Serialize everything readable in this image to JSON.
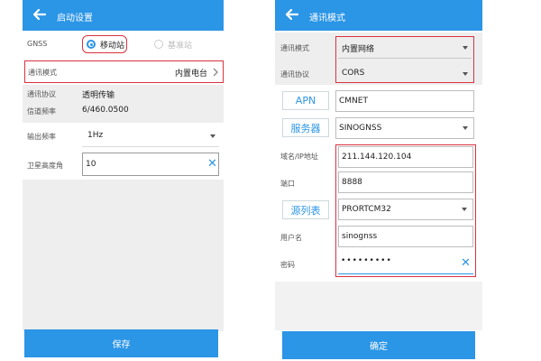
{
  "left": {
    "title": "启动设置",
    "gnss_label": "GNSS",
    "mode_mobile": "移动站",
    "mode_base": "基准站",
    "comm_mode_label": "通讯模式",
    "comm_mode_value": "内置电台",
    "protocol_label": "通讯协议",
    "protocol_value": "透明传输",
    "freq_label": "信道频率",
    "freq_value": "6/460.0500",
    "output_label": "输出频率",
    "output_value": "1Hz",
    "elev_label": "卫星高度角",
    "elev_value": "10",
    "save_label": "保存"
  },
  "right": {
    "title": "通讯模式",
    "comm_mode_label": "通讯模式",
    "comm_mode_value": "内置网络",
    "protocol_label": "通讯协议",
    "protocol_value": "CORS",
    "apn_label": "APN",
    "apn_value": "CMNET",
    "server_label": "服务器",
    "server_value": "SINOGNSS",
    "domain_label": "域名/IP地址",
    "domain_value": "211.144.120.104",
    "port_label": "端口",
    "port_value": "8888",
    "source_label": "源列表",
    "source_value": "PRORTCM32",
    "user_label": "用户名",
    "user_value": "sinognss",
    "pwd_label": "密码",
    "pwd_value": "•••••••••",
    "confirm_label": "确定"
  },
  "colors": {
    "accent": "#2b95e6",
    "highlight": "#d9333f"
  }
}
